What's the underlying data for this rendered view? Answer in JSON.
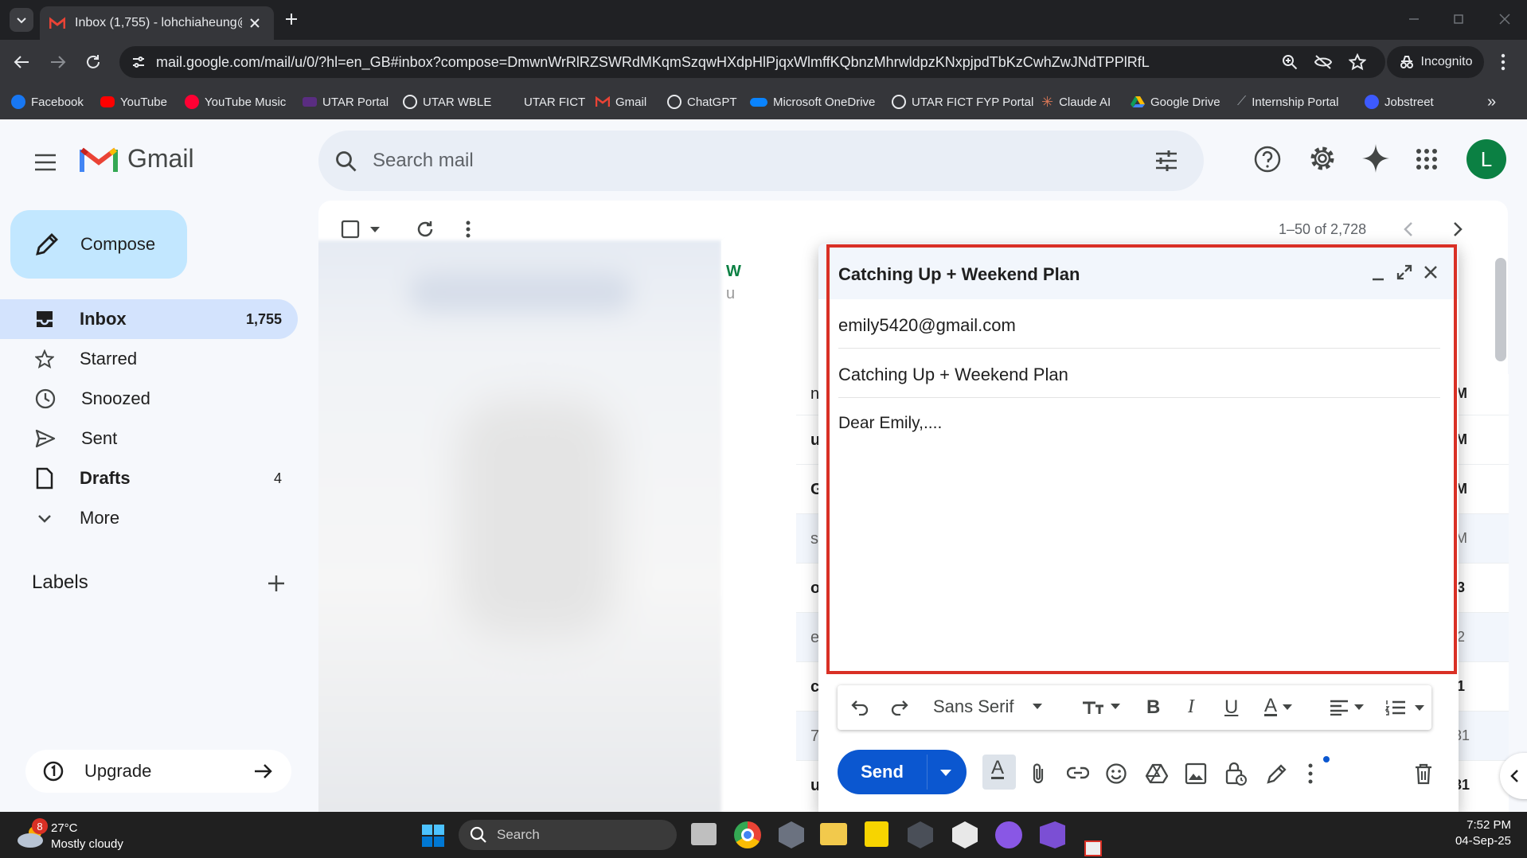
{
  "browser": {
    "tab_title": "Inbox (1,755) - lohchiaheung@",
    "url": "mail.google.com/mail/u/0/?hl=en_GB#inbox?compose=DmwnWrRlRZSWRdMKqmSzqwHXdpHlPjqxWlmffKQbnzMhrwldpzKNxpjpdTbKzCwhZwJNdTPPlRfL",
    "incognito_label": "Incognito",
    "bookmarks": [
      "Facebook",
      "YouTube",
      "YouTube Music",
      "UTAR Portal",
      "UTAR WBLE",
      "UTAR FICT",
      "Gmail",
      "ChatGPT",
      "Microsoft OneDrive",
      "UTAR FICT FYP Portal",
      "Claude AI",
      "Google Drive",
      "Internship Portal",
      "Jobstreet"
    ]
  },
  "gmail": {
    "logo_text": "Gmail",
    "search_placeholder": "Search mail",
    "avatar_letter": "L",
    "compose_label": "Compose",
    "nav": [
      {
        "label": "Inbox",
        "count": "1,755",
        "icon": "inbox-icon"
      },
      {
        "label": "Starred",
        "count": "",
        "icon": "star-icon"
      },
      {
        "label": "Snoozed",
        "count": "",
        "icon": "clock-icon"
      },
      {
        "label": "Sent",
        "count": "",
        "icon": "send-icon"
      },
      {
        "label": "Drafts",
        "count": "4",
        "icon": "draft-icon"
      },
      {
        "label": "More",
        "count": "",
        "icon": "chevron-down-icon"
      }
    ],
    "labels_heading": "Labels",
    "upgrade_label": "Upgrade",
    "pagination": "1–50 of 2,728",
    "list_edge": [
      {
        "letter": "W",
        "time": ""
      },
      {
        "letter": "u",
        "time": ""
      },
      {
        "letter": "n",
        "time": "M"
      },
      {
        "letter": "u",
        "time": "M"
      },
      {
        "letter": "G",
        "time": "M"
      },
      {
        "letter": "s",
        "time": "M"
      },
      {
        "letter": "o",
        "time": "3"
      },
      {
        "letter": "e",
        "time": "2"
      },
      {
        "letter": "c",
        "time": "1"
      },
      {
        "letter": "7",
        "time": "31"
      },
      {
        "letter": "u",
        "time": "31"
      }
    ]
  },
  "compose": {
    "title": "Catching Up + Weekend Plan",
    "to": "emily5420@gmail.com",
    "subject": "Catching Up + Weekend Plan",
    "body": "Dear Emily,....",
    "font": "Sans Serif",
    "send_label": "Send",
    "highlight_color": "#d93025"
  },
  "taskbar": {
    "weather_temp": "27°C",
    "weather_desc": "Mostly cloudy",
    "weather_badge": "8",
    "search_placeholder": "Search",
    "time": "7:52 PM",
    "date": "04-Sep-25"
  }
}
